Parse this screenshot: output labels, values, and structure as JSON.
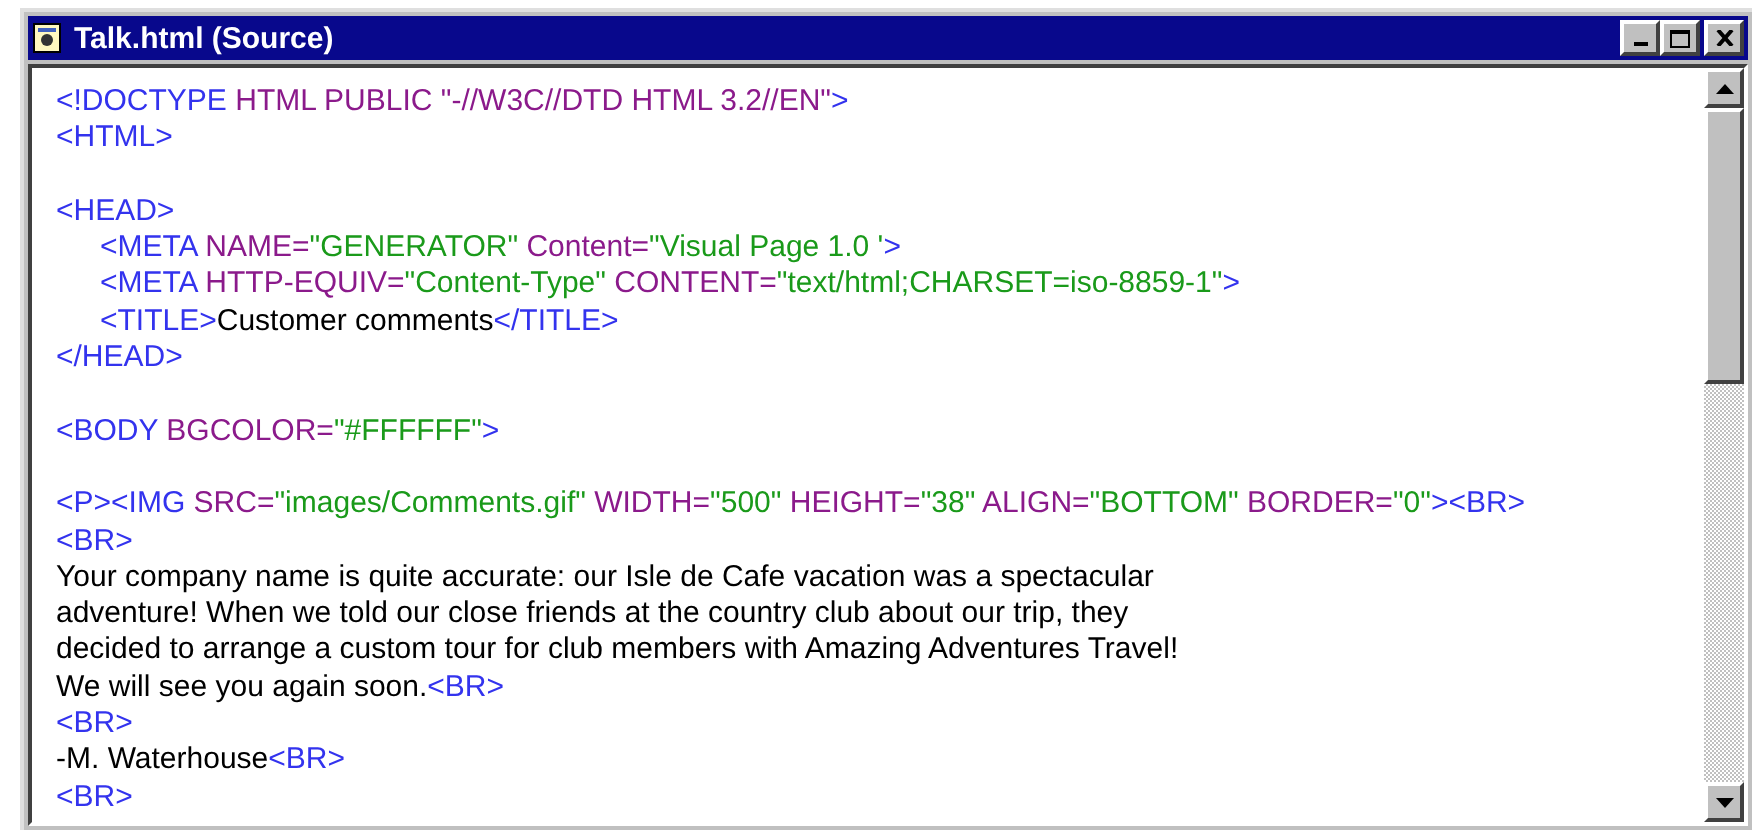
{
  "window": {
    "title": "Talk.html (Source)"
  },
  "source_lines": [
    {
      "kind": "code",
      "tokens": [
        {
          "kind": "tag",
          "text": "<!DOCTYPE"
        },
        {
          "kind": "attr",
          "text": " HTML PUBLIC \"-//W3C//DTD HTML 3.2//EN\""
        },
        {
          "kind": "tag",
          "text": ">"
        }
      ]
    },
    {
      "kind": "code",
      "tokens": [
        {
          "kind": "tag",
          "text": "<HTML>"
        }
      ]
    },
    {
      "kind": "blank"
    },
    {
      "kind": "code",
      "tokens": [
        {
          "kind": "tag",
          "text": "<HEAD>"
        }
      ],
      "children": [
        {
          "kind": "code",
          "tokens": [
            {
              "kind": "tag",
              "text": "<META"
            },
            {
              "kind": "attr",
              "text": " NAME="
            },
            {
              "kind": "value",
              "text": "\"GENERATOR\""
            },
            {
              "kind": "attr",
              "text": " Content="
            },
            {
              "kind": "value",
              "text": "\"Visual Page 1.0 '"
            },
            {
              "kind": "tag",
              "text": ">"
            }
          ]
        },
        {
          "kind": "code",
          "tokens": [
            {
              "kind": "tag",
              "text": "<META"
            },
            {
              "kind": "attr",
              "text": " HTTP-EQUIV="
            },
            {
              "kind": "value",
              "text": "\"Content-Type\""
            },
            {
              "kind": "attr",
              "text": " CONTENT="
            },
            {
              "kind": "value",
              "text": "\"text/html;CHARSET=iso-8859-1\""
            },
            {
              "kind": "tag",
              "text": ">"
            }
          ]
        },
        {
          "kind": "code",
          "tokens": [
            {
              "kind": "tag",
              "text": "<TITLE>"
            },
            {
              "kind": "text",
              "text": "Customer comments"
            },
            {
              "kind": "tag",
              "text": "</TITLE>"
            }
          ]
        }
      ]
    },
    {
      "kind": "code",
      "tokens": [
        {
          "kind": "tag",
          "text": "</HEAD>"
        }
      ]
    },
    {
      "kind": "blank"
    },
    {
      "kind": "code",
      "tokens": [
        {
          "kind": "tag",
          "text": "<BODY"
        },
        {
          "kind": "attr",
          "text": " BGCOLOR="
        },
        {
          "kind": "value",
          "text": "\"#FFFFFF\""
        },
        {
          "kind": "tag",
          "text": ">"
        }
      ]
    },
    {
      "kind": "blank"
    },
    {
      "kind": "code",
      "tokens": [
        {
          "kind": "tag",
          "text": "<P><IMG"
        },
        {
          "kind": "attr",
          "text": " SRC="
        },
        {
          "kind": "value",
          "text": "\"images/Comments.gif\""
        },
        {
          "kind": "attr",
          "text": " WIDTH="
        },
        {
          "kind": "value",
          "text": "\"500\""
        },
        {
          "kind": "attr",
          "text": " HEIGHT="
        },
        {
          "kind": "value",
          "text": "\"38\""
        },
        {
          "kind": "attr",
          "text": " ALIGN="
        },
        {
          "kind": "value",
          "text": "\"BOTTOM\""
        },
        {
          "kind": "attr",
          "text": " BORDER="
        },
        {
          "kind": "value",
          "text": "\"0\""
        },
        {
          "kind": "tag",
          "text": "><BR>"
        }
      ]
    },
    {
      "kind": "code",
      "tokens": [
        {
          "kind": "tag",
          "text": "<BR>"
        }
      ]
    },
    {
      "kind": "code",
      "tokens": [
        {
          "kind": "text",
          "text": "Your company name is quite accurate: our Isle de Cafe vacation was a spectacular"
        }
      ]
    },
    {
      "kind": "code",
      "tokens": [
        {
          "kind": "text",
          "text": "adventure! When we told our close friends at the country club about our trip, they"
        }
      ]
    },
    {
      "kind": "code",
      "tokens": [
        {
          "kind": "text",
          "text": "decided to arrange a custom tour for club members with Amazing Adventures Travel!"
        }
      ]
    },
    {
      "kind": "code",
      "tokens": [
        {
          "kind": "text",
          "text": "We will see you again soon."
        },
        {
          "kind": "tag",
          "text": "<BR>"
        }
      ]
    },
    {
      "kind": "code",
      "tokens": [
        {
          "kind": "tag",
          "text": "<BR>"
        }
      ]
    },
    {
      "kind": "code",
      "tokens": [
        {
          "kind": "text",
          "text": "-M. Waterhouse"
        },
        {
          "kind": "tag",
          "text": "<BR>"
        }
      ]
    },
    {
      "kind": "code",
      "tokens": [
        {
          "kind": "tag",
          "text": "<BR>"
        }
      ]
    }
  ]
}
